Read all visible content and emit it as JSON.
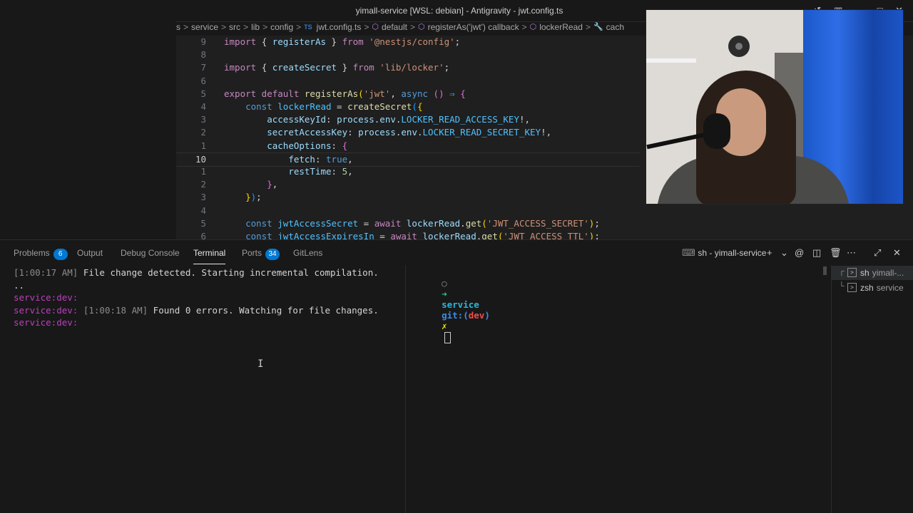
{
  "window": {
    "title": "yimall-service [WSL: debian] - Antigravity - jwt.config.ts",
    "controls": [
      "history-icon",
      "layout-icon",
      "minimize-icon",
      "maximize-icon",
      "close-icon"
    ]
  },
  "breadcrumb": {
    "items": [
      "s",
      "service",
      "src",
      "lib",
      "config",
      "jwt.config.ts",
      "default",
      "registerAs('jwt') callback",
      "lockerRead",
      "cach"
    ],
    "file_badge": "TS"
  },
  "editor": {
    "lines": [
      {
        "n": "9",
        "tokens": [
          [
            "kw",
            "import "
          ],
          [
            "pl",
            "{ "
          ],
          [
            "var",
            "registerAs"
          ],
          [
            "pl",
            " } "
          ],
          [
            "kw",
            "from "
          ],
          [
            "str",
            "'@nestjs/config'"
          ],
          [
            "pl",
            ";"
          ]
        ]
      },
      {
        "n": "8",
        "tokens": []
      },
      {
        "n": "7",
        "tokens": [
          [
            "kw",
            "import "
          ],
          [
            "pl",
            "{ "
          ],
          [
            "var",
            "createSecret"
          ],
          [
            "pl",
            " } "
          ],
          [
            "kw",
            "from "
          ],
          [
            "str",
            "'lib/locker'"
          ],
          [
            "pl",
            ";"
          ]
        ]
      },
      {
        "n": "6",
        "tokens": []
      },
      {
        "n": "5",
        "tokens": [
          [
            "kw",
            "export default "
          ],
          [
            "fn",
            "registerAs"
          ],
          [
            "br1",
            "("
          ],
          [
            "str",
            "'jwt'"
          ],
          [
            "pl",
            ", "
          ],
          [
            "kwb",
            "async "
          ],
          [
            "br2",
            "()"
          ],
          [
            "kwb",
            " ⇒ "
          ],
          [
            "br2",
            "{"
          ]
        ]
      },
      {
        "n": "4",
        "tokens": [
          [
            "pl",
            "    "
          ],
          [
            "kwb",
            "const "
          ],
          [
            "const",
            "lockerRead"
          ],
          [
            "pl",
            " = "
          ],
          [
            "fn",
            "createSecret"
          ],
          [
            "br3",
            "("
          ],
          [
            "br1",
            "{"
          ]
        ]
      },
      {
        "n": "3",
        "tokens": [
          [
            "pl",
            "        "
          ],
          [
            "var",
            "accessKeyId"
          ],
          [
            "pl",
            ": "
          ],
          [
            "var",
            "process"
          ],
          [
            "pl",
            "."
          ],
          [
            "var",
            "env"
          ],
          [
            "pl",
            "."
          ],
          [
            "const",
            "LOCKER_READ_ACCESS_KEY"
          ],
          [
            "pl",
            "!,"
          ]
        ]
      },
      {
        "n": "2",
        "tokens": [
          [
            "pl",
            "        "
          ],
          [
            "var",
            "secretAccessKey"
          ],
          [
            "pl",
            ": "
          ],
          [
            "var",
            "process"
          ],
          [
            "pl",
            "."
          ],
          [
            "var",
            "env"
          ],
          [
            "pl",
            "."
          ],
          [
            "const",
            "LOCKER_READ_SECRET_KEY"
          ],
          [
            "pl",
            "!,"
          ]
        ]
      },
      {
        "n": "1",
        "tokens": [
          [
            "pl",
            "        "
          ],
          [
            "var",
            "cacheOptions"
          ],
          [
            "pl",
            ": "
          ],
          [
            "br2",
            "{"
          ]
        ]
      },
      {
        "n": "10",
        "current": true,
        "tokens": [
          [
            "pl",
            "            "
          ],
          [
            "var",
            "fetch"
          ],
          [
            "pl",
            ": "
          ],
          [
            "bool",
            "true"
          ],
          [
            "pl",
            ","
          ]
        ]
      },
      {
        "n": "1",
        "tokens": [
          [
            "pl",
            "            "
          ],
          [
            "var",
            "restTime"
          ],
          [
            "pl",
            ": "
          ],
          [
            "num",
            "5"
          ],
          [
            "pl",
            ","
          ]
        ]
      },
      {
        "n": "2",
        "tokens": [
          [
            "pl",
            "        "
          ],
          [
            "br2",
            "}"
          ],
          [
            "pl",
            ","
          ]
        ]
      },
      {
        "n": "3",
        "tokens": [
          [
            "pl",
            "    "
          ],
          [
            "br1",
            "}"
          ],
          [
            "br3",
            ")"
          ],
          [
            "pl",
            ";"
          ]
        ]
      },
      {
        "n": "4",
        "tokens": []
      },
      {
        "n": "5",
        "tokens": [
          [
            "pl",
            "    "
          ],
          [
            "kwb",
            "const "
          ],
          [
            "const",
            "jwtAccessSecret"
          ],
          [
            "pl",
            " = "
          ],
          [
            "kw",
            "await "
          ],
          [
            "var",
            "lockerRead"
          ],
          [
            "pl",
            "."
          ],
          [
            "fn",
            "get"
          ],
          [
            "br1",
            "("
          ],
          [
            "str",
            "'JWT_ACCESS_SECRET'"
          ],
          [
            "br1",
            ")"
          ],
          [
            "pl",
            ";"
          ]
        ]
      },
      {
        "n": "6",
        "tokens": [
          [
            "pl",
            "    "
          ],
          [
            "kwb",
            "const "
          ],
          [
            "const",
            "jwtAccessExpiresIn"
          ],
          [
            "pl",
            " = "
          ],
          [
            "kw",
            "await "
          ],
          [
            "var",
            "lockerRead"
          ],
          [
            "pl",
            "."
          ],
          [
            "fn",
            "get"
          ],
          [
            "br1",
            "("
          ],
          [
            "str",
            "'JWT_ACCESS_TTL'"
          ],
          [
            "br1",
            ")"
          ],
          [
            "pl",
            ";"
          ]
        ]
      }
    ]
  },
  "panel": {
    "tabs": [
      {
        "label": "Problems",
        "badge": "6"
      },
      {
        "label": "Output",
        "badge": ""
      },
      {
        "label": "Debug Console",
        "badge": ""
      },
      {
        "label": "Terminal",
        "badge": ""
      },
      {
        "label": "Ports",
        "badge": "34"
      },
      {
        "label": "GitLens",
        "badge": ""
      }
    ],
    "terminal_title": "sh - yimall-service"
  },
  "terminal_left": {
    "lines": [
      {
        "parts": [
          [
            "tgray",
            "[1:00:17 AM]"
          ],
          [
            "pl",
            " File change detected. Starting incremental compilation."
          ]
        ]
      },
      {
        "parts": [
          [
            "pl",
            ".."
          ]
        ]
      },
      {
        "parts": [
          [
            "tpurple",
            "service:dev:"
          ]
        ]
      },
      {
        "parts": [
          [
            "tpurple",
            "service:dev: "
          ],
          [
            "tgray",
            "[1:00:18 AM]"
          ],
          [
            "pl",
            " Found 0 errors. Watching for file changes."
          ]
        ]
      },
      {
        "parts": [
          [
            "tpurple",
            "service:dev:"
          ]
        ]
      }
    ]
  },
  "terminal_right": {
    "prompt_dir": "service",
    "prompt_git": "git:(",
    "prompt_branch": "dev",
    "prompt_git_close": ")",
    "prompt_x": "✗"
  },
  "terminal_list": [
    {
      "name": "sh",
      "sub": "yimall-...",
      "active": true
    },
    {
      "name": "zsh",
      "sub": "service",
      "active": false
    }
  ]
}
